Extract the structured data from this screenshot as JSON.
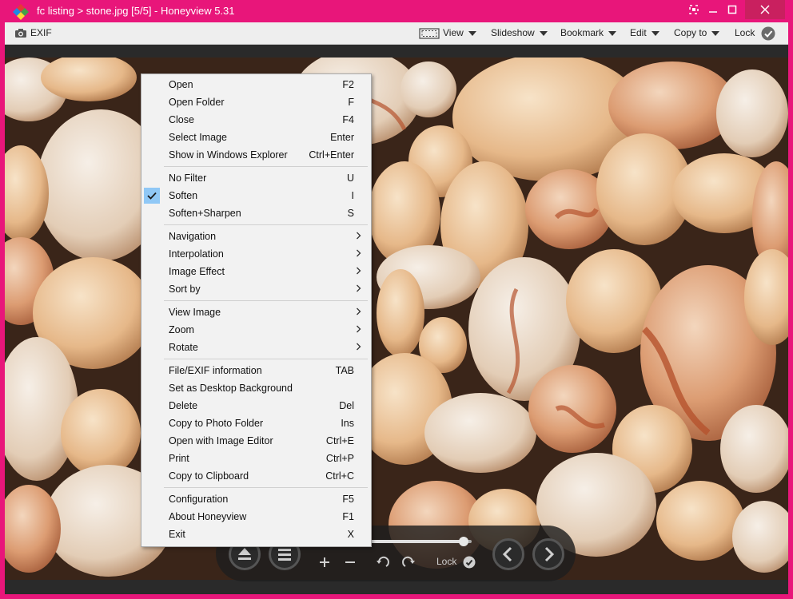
{
  "colors": {
    "frame": "#e8167a",
    "toolbar_bg": "#eeeeee",
    "menu_bg": "#f2f2f2",
    "check_bg": "#90c8f6"
  },
  "titlebar": {
    "title": "fc listing > stone.jpg [5/5] - Honeyview 5.31",
    "buttons": [
      "fullscreen-icon",
      "minimize-icon",
      "maximize-icon",
      "close-icon"
    ]
  },
  "toolbar": {
    "exif_label": "EXIF",
    "menus": [
      "View",
      "Slideshow",
      "Bookmark",
      "Edit",
      "Copy to"
    ],
    "lock_label": "Lock"
  },
  "context_menu": {
    "groups": [
      [
        {
          "label": "Open",
          "shortcut": "F2"
        },
        {
          "label": "Open Folder",
          "shortcut": "F"
        },
        {
          "label": "Close",
          "shortcut": "F4"
        },
        {
          "label": "Select Image",
          "shortcut": "Enter"
        },
        {
          "label": "Show in Windows Explorer",
          "shortcut": "Ctrl+Enter"
        }
      ],
      [
        {
          "label": "No Filter",
          "shortcut": "U"
        },
        {
          "label": "Soften",
          "shortcut": "I",
          "checked": true
        },
        {
          "label": "Soften+Sharpen",
          "shortcut": "S"
        }
      ],
      [
        {
          "label": "Navigation",
          "submenu": true
        },
        {
          "label": "Interpolation",
          "submenu": true
        },
        {
          "label": "Image Effect",
          "submenu": true
        },
        {
          "label": "Sort by",
          "submenu": true
        }
      ],
      [
        {
          "label": "View Image",
          "submenu": true
        },
        {
          "label": "Zoom",
          "submenu": true
        },
        {
          "label": "Rotate",
          "submenu": true
        }
      ],
      [
        {
          "label": "File/EXIF information",
          "shortcut": "TAB"
        },
        {
          "label": "Set as Desktop Background",
          "shortcut": ""
        },
        {
          "label": "Delete",
          "shortcut": "Del"
        },
        {
          "label": "Copy to Photo Folder",
          "shortcut": "Ins"
        },
        {
          "label": "Open with Image Editor",
          "shortcut": "Ctrl+E"
        },
        {
          "label": "Print",
          "shortcut": "Ctrl+P"
        },
        {
          "label": "Copy to Clipboard",
          "shortcut": "Ctrl+C"
        }
      ],
      [
        {
          "label": "Configuration",
          "shortcut": "F5"
        },
        {
          "label": "About Honeyview",
          "shortcut": "F1"
        },
        {
          "label": "Exit",
          "shortcut": "X"
        }
      ]
    ]
  },
  "controls": {
    "lock_label": "Lock",
    "icons": [
      "eject-icon",
      "menu-icon",
      "zoom-in-icon",
      "zoom-out-icon",
      "rotate-left-icon",
      "rotate-right-icon",
      "lock-check-icon",
      "previous-icon",
      "next-icon"
    ],
    "progress": 0.92
  }
}
